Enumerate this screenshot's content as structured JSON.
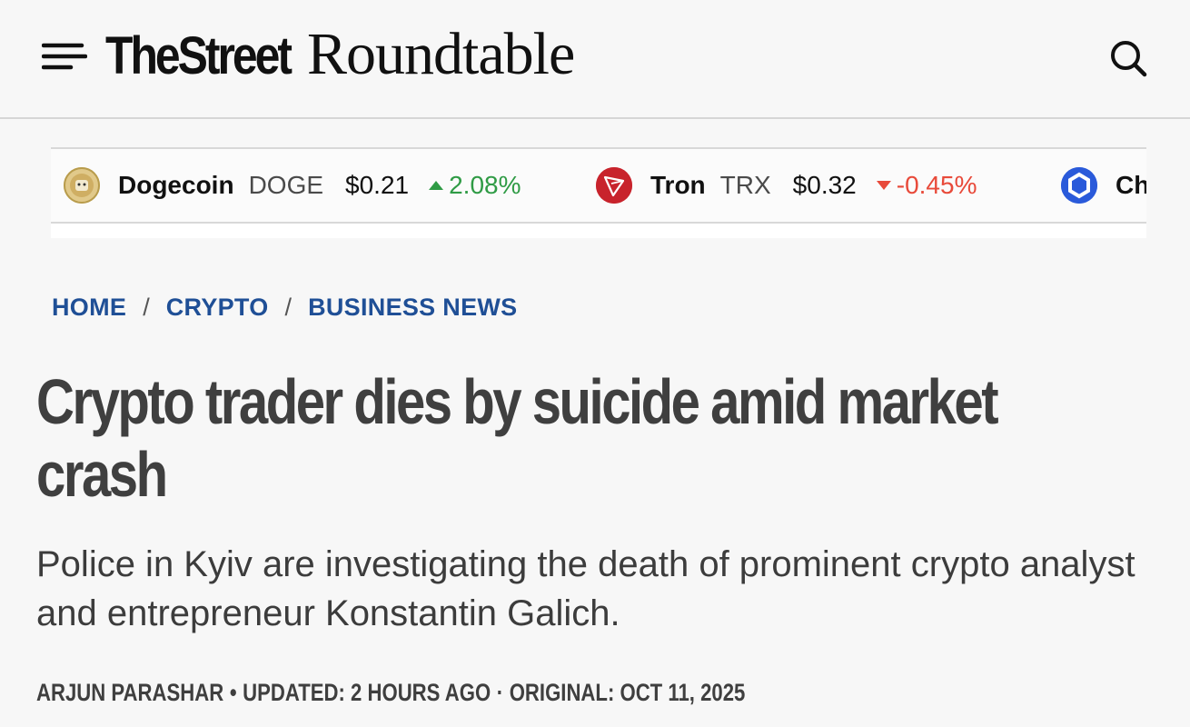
{
  "header": {
    "logo_part1": "TheStreet",
    "logo_part2": "Roundtable"
  },
  "ticker": {
    "items": [
      {
        "icon": "dogecoin-icon",
        "name": "Dogecoin",
        "symbol": "DOGE",
        "price": "$0.21",
        "change": "2.08%",
        "direction": "up",
        "color": "#d4b56a"
      },
      {
        "icon": "tron-icon",
        "name": "Tron",
        "symbol": "TRX",
        "price": "$0.32",
        "change": "-0.45%",
        "direction": "down",
        "color": "#c8232c"
      },
      {
        "icon": "chainlink-icon",
        "name": "Ch",
        "color": "#2a5ada"
      }
    ]
  },
  "breadcrumb": {
    "items": [
      "HOME",
      "CRYPTO",
      "BUSINESS NEWS"
    ],
    "separator": "/"
  },
  "article": {
    "headline": "Crypto trader dies by suicide amid market crash",
    "dek": "Police in Kyiv are investigating the death of prominent crypto analyst and entrepreneur Konstantin Galich.",
    "author": "ARJUN PARASHAR",
    "separator1": "•",
    "updated": "UPDATED: 2 HOURS AGO",
    "separator2": "·",
    "original": "ORIGINAL: OCT 11, 2025"
  },
  "colors": {
    "link_blue": "#1f4f96",
    "up_green": "#2f9b45",
    "down_red": "#e84a3a"
  }
}
